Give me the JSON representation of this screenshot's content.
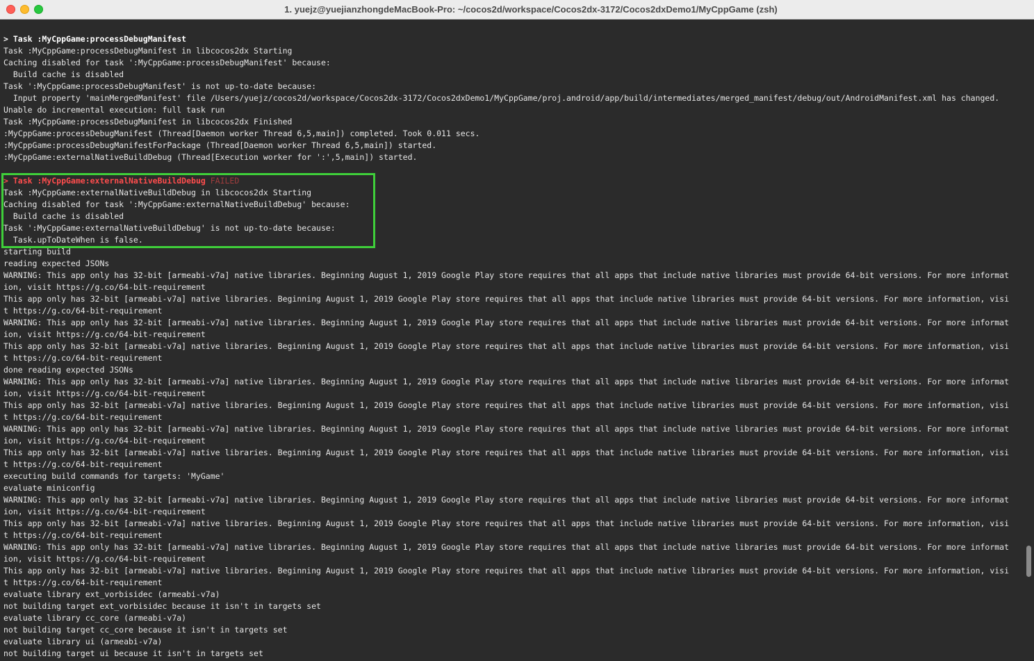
{
  "window": {
    "title": "1. yuejz@yuejianzhongdeMacBook-Pro: ~/cocos2d/workspace/Cocos2dx-3172/Cocos2dxDemo1/MyCppGame (zsh)"
  },
  "colors": {
    "background": "#2b2b2b",
    "text": "#e6e6e6",
    "error_red": "#ff4d4d",
    "highlight_green": "#3fcf3a"
  },
  "terminal": {
    "lines": [
      "> Task :MyCppGame:processDebugManifest",
      "Task :MyCppGame:processDebugManifest in libcocos2dx Starting",
      "Caching disabled for task ':MyCppGame:processDebugManifest' because:",
      "  Build cache is disabled",
      "Task ':MyCppGame:processDebugManifest' is not up-to-date because:",
      "  Input property 'mainMergedManifest' file /Users/yuejz/cocos2d/workspace/Cocos2dx-3172/Cocos2dxDemo1/MyCppGame/proj.android/app/build/intermediates/merged_manifest/debug/out/AndroidManifest.xml has changed.",
      "Unable do incremental execution: full task run",
      "Task :MyCppGame:processDebugManifest in libcocos2dx Finished",
      ":MyCppGame:processDebugManifest (Thread[Daemon worker Thread 6,5,main]) completed. Took 0.011 secs.",
      ":MyCppGame:processDebugManifestForPackage (Thread[Daemon worker Thread 6,5,main]) started.",
      ":MyCppGame:externalNativeBuildDebug (Thread[Execution worker for ':',5,main]) started.",
      "",
      "> Task :MyCppGame:externalNativeBuildDebug",
      "Task :MyCppGame:externalNativeBuildDebug in libcocos2dx Starting",
      "Caching disabled for task ':MyCppGame:externalNativeBuildDebug' because:",
      "  Build cache is disabled",
      "Task ':MyCppGame:externalNativeBuildDebug' is not up-to-date because:",
      "  Task.upToDateWhen is false.",
      "starting build",
      "reading expected JSONs",
      "WARNING: This app only has 32-bit [armeabi-v7a] native libraries. Beginning August 1, 2019 Google Play store requires that all apps that include native libraries must provide 64-bit versions. For more informat",
      "ion, visit https://g.co/64-bit-requirement",
      "This app only has 32-bit [armeabi-v7a] native libraries. Beginning August 1, 2019 Google Play store requires that all apps that include native libraries must provide 64-bit versions. For more information, visi",
      "t https://g.co/64-bit-requirement",
      "WARNING: This app only has 32-bit [armeabi-v7a] native libraries. Beginning August 1, 2019 Google Play store requires that all apps that include native libraries must provide 64-bit versions. For more informat",
      "ion, visit https://g.co/64-bit-requirement",
      "This app only has 32-bit [armeabi-v7a] native libraries. Beginning August 1, 2019 Google Play store requires that all apps that include native libraries must provide 64-bit versions. For more information, visi",
      "t https://g.co/64-bit-requirement",
      "done reading expected JSONs",
      "WARNING: This app only has 32-bit [armeabi-v7a] native libraries. Beginning August 1, 2019 Google Play store requires that all apps that include native libraries must provide 64-bit versions. For more informat",
      "ion, visit https://g.co/64-bit-requirement",
      "This app only has 32-bit [armeabi-v7a] native libraries. Beginning August 1, 2019 Google Play store requires that all apps that include native libraries must provide 64-bit versions. For more information, visi",
      "t https://g.co/64-bit-requirement",
      "WARNING: This app only has 32-bit [armeabi-v7a] native libraries. Beginning August 1, 2019 Google Play store requires that all apps that include native libraries must provide 64-bit versions. For more informat",
      "ion, visit https://g.co/64-bit-requirement",
      "This app only has 32-bit [armeabi-v7a] native libraries. Beginning August 1, 2019 Google Play store requires that all apps that include native libraries must provide 64-bit versions. For more information, visi",
      "t https://g.co/64-bit-requirement",
      "executing build commands for targets: 'MyGame'",
      "evaluate miniconfig",
      "WARNING: This app only has 32-bit [armeabi-v7a] native libraries. Beginning August 1, 2019 Google Play store requires that all apps that include native libraries must provide 64-bit versions. For more informat",
      "ion, visit https://g.co/64-bit-requirement",
      "This app only has 32-bit [armeabi-v7a] native libraries. Beginning August 1, 2019 Google Play store requires that all apps that include native libraries must provide 64-bit versions. For more information, visi",
      "t https://g.co/64-bit-requirement",
      "WARNING: This app only has 32-bit [armeabi-v7a] native libraries. Beginning August 1, 2019 Google Play store requires that all apps that include native libraries must provide 64-bit versions. For more informat",
      "ion, visit https://g.co/64-bit-requirement",
      "This app only has 32-bit [armeabi-v7a] native libraries. Beginning August 1, 2019 Google Play store requires that all apps that include native libraries must provide 64-bit versions. For more information, visi",
      "t https://g.co/64-bit-requirement",
      "evaluate library ext_vorbisidec (armeabi-v7a)",
      "not building target ext_vorbisidec because it isn't in targets set",
      "evaluate library cc_core (armeabi-v7a)",
      "not building target cc_core because it isn't in targets set",
      "evaluate library ui (armeabi-v7a)",
      "not building target ui because it isn't in targets set"
    ],
    "failed_suffix": " FAILED",
    "bold_line_indexes": [
      0
    ],
    "error_line_index": 12,
    "highlight": {
      "first_line_index": 12,
      "last_line_index": 17
    }
  }
}
